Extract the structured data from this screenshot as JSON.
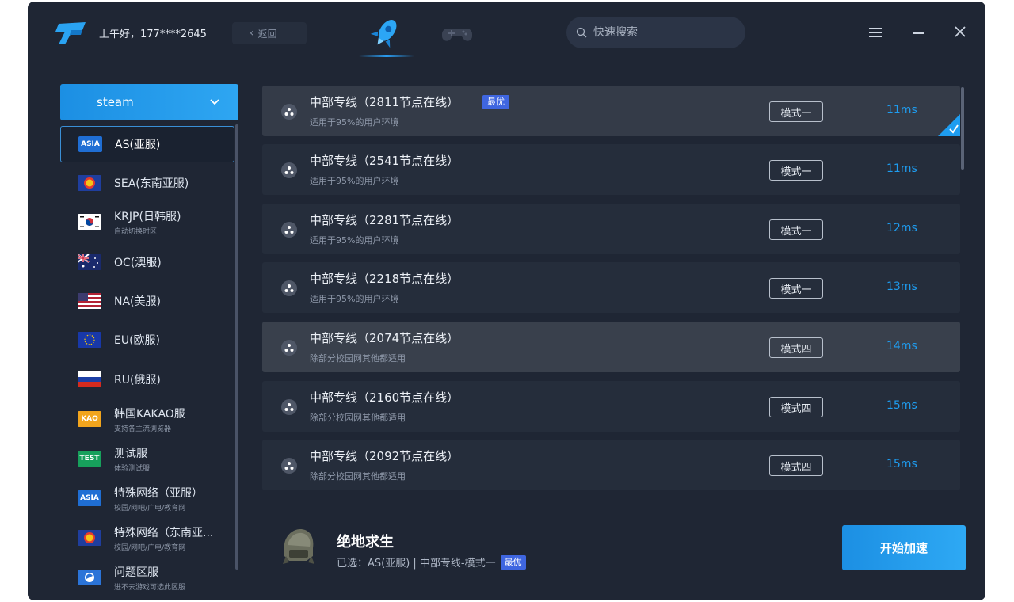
{
  "header": {
    "greeting": "上午好，177****2645",
    "back_label": "返回",
    "search_placeholder": "快速搜索"
  },
  "platform": {
    "label": "steam"
  },
  "regions": [
    {
      "code": "ASIA",
      "name": "AS(亚服)",
      "sub": "",
      "icon": "asia-badge",
      "active": true
    },
    {
      "code": "",
      "name": "SEA(东南亚服)",
      "sub": "",
      "icon": "asean-flag",
      "active": false
    },
    {
      "code": "",
      "name": "KRJP(日韩服)",
      "sub": "自动切换时区",
      "icon": "korea-flag",
      "active": false
    },
    {
      "code": "",
      "name": "OC(澳服)",
      "sub": "",
      "icon": "australia-flag",
      "active": false
    },
    {
      "code": "",
      "name": "NA(美服)",
      "sub": "",
      "icon": "usa-flag",
      "active": false
    },
    {
      "code": "",
      "name": "EU(欧服)",
      "sub": "",
      "icon": "eu-flag",
      "active": false
    },
    {
      "code": "",
      "name": "RU(俄服)",
      "sub": "",
      "icon": "russia-flag",
      "active": false
    },
    {
      "code": "KAO",
      "name": "韩国KAKAO服",
      "sub": "支持各主流浏览器",
      "icon": "kao-badge",
      "active": false
    },
    {
      "code": "TEST",
      "name": "测试服",
      "sub": "体验测试服",
      "icon": "test-badge",
      "active": false
    },
    {
      "code": "ASIA",
      "name": "特殊网络（亚服）",
      "sub": "校园/网吧/广电/教育网",
      "icon": "asia-badge",
      "active": false
    },
    {
      "code": "",
      "name": "特殊网络（东南亚...",
      "sub": "校园/网吧/广电/教育网",
      "icon": "asean-flag",
      "active": false
    },
    {
      "code": "",
      "name": "问题区服",
      "sub": "进不去游戏可选此区服",
      "icon": "problem-badge",
      "active": false
    }
  ],
  "routes": [
    {
      "title": "中部专线（2811节点在线）",
      "desc": "适用于95%的用户环境",
      "mode": "模式一",
      "latency": "11ms",
      "badge": "最优",
      "selected": true
    },
    {
      "title": "中部专线（2541节点在线）",
      "desc": "适用于95%的用户环境",
      "mode": "模式一",
      "latency": "11ms",
      "badge": "",
      "selected": false
    },
    {
      "title": "中部专线（2281节点在线）",
      "desc": "适用于95%的用户环境",
      "mode": "模式一",
      "latency": "12ms",
      "badge": "",
      "selected": false
    },
    {
      "title": "中部专线（2218节点在线）",
      "desc": "适用于95%的用户环境",
      "mode": "模式一",
      "latency": "13ms",
      "badge": "",
      "selected": false
    },
    {
      "title": "中部专线（2074节点在线）",
      "desc": "除部分校园网其他都适用",
      "mode": "模式四",
      "latency": "14ms",
      "badge": "",
      "selected": false
    },
    {
      "title": "中部专线（2160节点在线）",
      "desc": "除部分校园网其他都适用",
      "mode": "模式四",
      "latency": "15ms",
      "badge": "",
      "selected": false
    },
    {
      "title": "中部专线（2092节点在线）",
      "desc": "除部分校园网其他都适用",
      "mode": "模式四",
      "latency": "15ms",
      "badge": "",
      "selected": false
    }
  ],
  "footer": {
    "game_name": "绝地求生",
    "selection": "已选：AS(亚服) | 中部专线-模式一",
    "selection_badge": "最优",
    "start_label": "开始加速"
  },
  "colors": {
    "accent": "#1e9df1",
    "window_bg": "#1f2634",
    "badge_blue": "#3f66e0"
  }
}
